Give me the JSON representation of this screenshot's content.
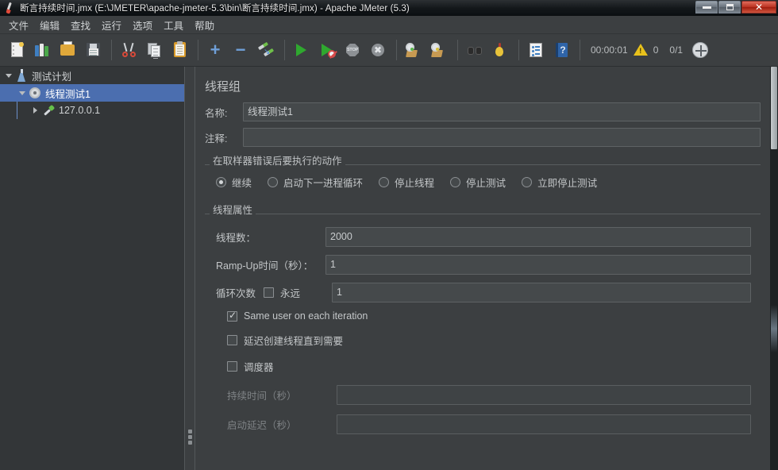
{
  "window": {
    "title": "断言持续时间.jmx (E:\\JMETER\\apache-jmeter-5.3\\bin\\断言持续时间.jmx) - Apache JMeter (5.3)",
    "app_icon": "jmeter-feather-icon",
    "controls": {
      "minimize": "minimize-button",
      "maximize": "maximize-button",
      "close": "close-button"
    }
  },
  "menubar": {
    "items": [
      {
        "label": "文件",
        "name": "menu-file"
      },
      {
        "label": "编辑",
        "name": "menu-edit"
      },
      {
        "label": "查找",
        "name": "menu-search"
      },
      {
        "label": "运行",
        "name": "menu-run"
      },
      {
        "label": "选项",
        "name": "menu-options"
      },
      {
        "label": "工具",
        "name": "menu-tools"
      },
      {
        "label": "帮助",
        "name": "menu-help"
      }
    ]
  },
  "toolbar": {
    "buttons": [
      {
        "name": "new-icon",
        "title": "新建"
      },
      {
        "name": "templates-icon",
        "title": "模板"
      },
      {
        "name": "open-icon",
        "title": "打开"
      },
      {
        "name": "save-icon",
        "title": "保存"
      },
      {
        "name": "cut-icon",
        "title": "剪切"
      },
      {
        "name": "copy-icon",
        "title": "复制"
      },
      {
        "name": "paste-icon",
        "title": "粘贴"
      },
      {
        "name": "expand-all-icon",
        "title": "展开"
      },
      {
        "name": "collapse-all-icon",
        "title": "折叠"
      },
      {
        "name": "toggle-icon",
        "title": "切换"
      },
      {
        "name": "start-icon",
        "title": "启动"
      },
      {
        "name": "start-no-pause-icon",
        "title": "无间断启动"
      },
      {
        "name": "stop-icon",
        "title": "停止"
      },
      {
        "name": "shutdown-icon",
        "title": "关闭"
      },
      {
        "name": "clear-icon",
        "title": "清除"
      },
      {
        "name": "clear-all-icon",
        "title": "清除全部"
      },
      {
        "name": "search-icon",
        "title": "搜索"
      },
      {
        "name": "reset-search-icon",
        "title": "重置搜索"
      },
      {
        "name": "function-helper-icon",
        "title": "函数助手对话框"
      },
      {
        "name": "help-icon",
        "title": "帮助"
      }
    ],
    "status": {
      "elapsed_time": "00:00:01",
      "warning_icon": "warning-triangle-icon",
      "warning_count": "0",
      "threads": "0/1",
      "navigate_icon": "navigate-icon"
    }
  },
  "tree": {
    "nodes": [
      {
        "label": "测试计划",
        "icon": "test-plan-flask-icon",
        "expanded": true,
        "selected": false,
        "depth": 0,
        "name": "tree-node-test-plan"
      },
      {
        "label": "线程测试1",
        "icon": "thread-group-gear-icon",
        "expanded": true,
        "selected": true,
        "depth": 1,
        "name": "tree-node-thread-group"
      },
      {
        "label": "127.0.0.1",
        "icon": "sampler-dropper-icon",
        "expanded": false,
        "selected": false,
        "depth": 2,
        "name": "tree-node-sampler"
      }
    ]
  },
  "main": {
    "panel_title": "线程组",
    "name_label": "名称:",
    "name_value": "线程测试1",
    "comment_label": "注释:",
    "comment_value": "",
    "error_action": {
      "legend": "在取样器错误后要执行的动作",
      "options": [
        {
          "label": "继续",
          "selected": true,
          "name": "radio-continue"
        },
        {
          "label": "启动下一进程循环",
          "selected": false,
          "name": "radio-start-next-loop"
        },
        {
          "label": "停止线程",
          "selected": false,
          "name": "radio-stop-thread"
        },
        {
          "label": "停止测试",
          "selected": false,
          "name": "radio-stop-test"
        },
        {
          "label": "立即停止测试",
          "selected": false,
          "name": "radio-stop-test-now"
        }
      ]
    },
    "thread_properties": {
      "legend": "线程属性",
      "num_threads_label": "线程数：",
      "num_threads_value": "2000",
      "ramp_up_label": "Ramp-Up时间（秒）：",
      "ramp_up_value": "1",
      "loop_count_label": "循环次数",
      "loop_forever_label": "永远",
      "loop_forever_checked": false,
      "loop_count_value": "1",
      "same_user_label": "Same user on each iteration",
      "same_user_checked": true,
      "delay_create_label": "延迟创建线程直到需要",
      "delay_create_checked": false,
      "scheduler_label": "调度器",
      "scheduler_checked": false,
      "duration_label": "持续时间（秒）",
      "duration_value": "",
      "startup_delay_label": "启动延迟（秒）",
      "startup_delay_value": ""
    }
  },
  "colors": {
    "window_bg": "#3c3f41",
    "tree_bg": "#333638",
    "selection": "#4b6eaf",
    "field_bg": "#45494b",
    "text": "#c3c6c8",
    "disabled_text": "#7e8285"
  }
}
